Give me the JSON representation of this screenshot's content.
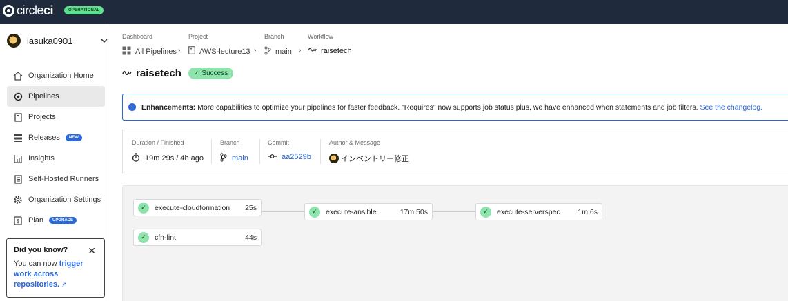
{
  "topbar": {
    "logo_text_a": "circle",
    "logo_text_b": "ci",
    "status": "OPERATIONAL"
  },
  "org": {
    "name": "iasuka0901"
  },
  "nav": [
    {
      "label": "Organization Home",
      "icon": "home-icon"
    },
    {
      "label": "Pipelines",
      "icon": "pipelines-icon",
      "active": true
    },
    {
      "label": "Projects",
      "icon": "projects-icon"
    },
    {
      "label": "Releases",
      "icon": "releases-icon",
      "badge": "NEW"
    },
    {
      "label": "Insights",
      "icon": "insights-icon"
    },
    {
      "label": "Self-Hosted Runners",
      "icon": "runners-icon"
    },
    {
      "label": "Organization Settings",
      "icon": "gear-icon"
    },
    {
      "label": "Plan",
      "icon": "plan-icon",
      "badge": "UPGRADE"
    }
  ],
  "tip": {
    "title": "Did you know?",
    "text_a": "You can now ",
    "link_a": "trigger",
    "link_b": "work across",
    "link_c": "repositories.",
    "link_icon": "↗"
  },
  "breadcrumbs": {
    "dashboard": {
      "label": "Dashboard",
      "value": "All Pipelines"
    },
    "project": {
      "label": "Project",
      "value": "AWS-lecture13"
    },
    "branch": {
      "label": "Branch",
      "value": "main"
    },
    "workflow": {
      "label": "Workflow",
      "value": "raisetech"
    }
  },
  "workflow": {
    "name": "raisetech",
    "status": "Success"
  },
  "banner": {
    "bold": "Enhancements:",
    "text": "More capabilities to optimize your pipelines for faster feedback. \"Requires\" now supports job status plus, we have enhanced when statements and job filters.",
    "link": "See the changelog."
  },
  "meta": {
    "duration_label": "Duration / Finished",
    "duration_value": "19m 29s / 4h ago",
    "branch_label": "Branch",
    "branch_value": "main",
    "commit_label": "Commit",
    "commit_value": "aa2529b",
    "author_label": "Author & Message",
    "author_value": "インベントリー修正"
  },
  "jobs": [
    {
      "name": "execute-cloudformation",
      "duration": "25s"
    },
    {
      "name": "cfn-lint",
      "duration": "44s"
    },
    {
      "name": "execute-ansible",
      "duration": "17m 50s"
    },
    {
      "name": "execute-serverspec",
      "duration": "1m 6s"
    }
  ],
  "colors": {
    "topbar": "#1f2a3c",
    "success": "#8fe3ad",
    "link": "#2a67d8",
    "operational": "#5ee08e"
  }
}
